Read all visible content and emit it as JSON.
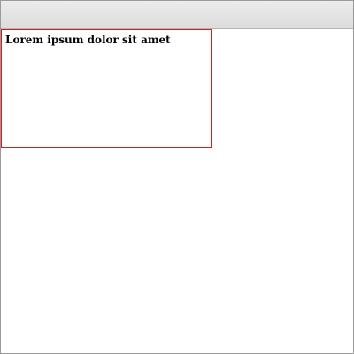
{
  "window": {
    "title": ""
  },
  "content": {
    "box_text": "Lorem ipsum dolor sit amet"
  },
  "colors": {
    "box_border": "#cc2222",
    "titlebar": "#dcdcdc",
    "window_border": "#9a9a9a"
  }
}
